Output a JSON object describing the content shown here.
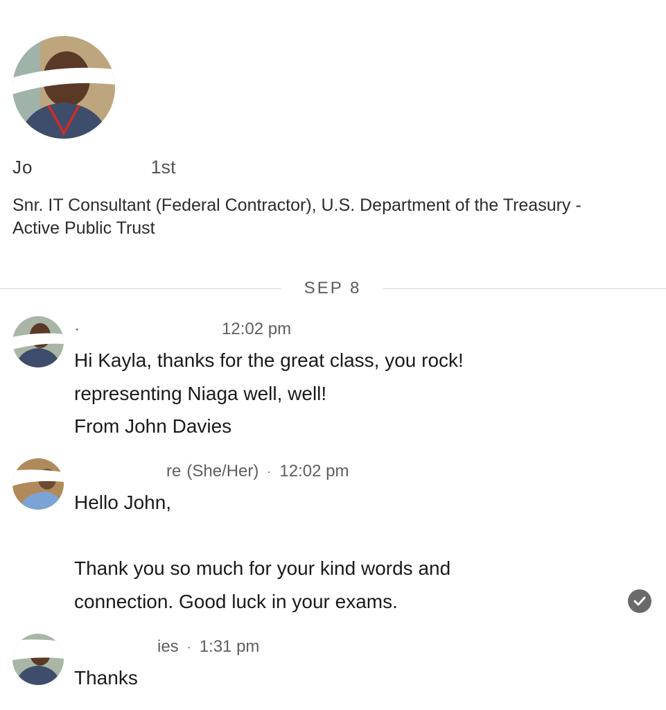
{
  "profile": {
    "name_fragment": "Jo",
    "connection_degree": "1st",
    "headline": "Snr. IT Consultant (Federal Contractor), U.S. Department of the Treasury - Active Public Trust"
  },
  "conversation": {
    "date_divider": "SEP 8",
    "messages": [
      {
        "sender_fragment": "·",
        "timestamp": "12:02 pm",
        "body": "Hi Kayla, thanks for the great class, you rock!\nrepresenting Niaga well, well!\nFrom John Davies"
      },
      {
        "sender_fragment": "re",
        "pronouns": "(She/Her)",
        "separator": "·",
        "timestamp": "12:02 pm",
        "body": "Hello John,\n\nThank you so much for your kind words and\nconnection. Good luck in your exams.",
        "status_icon": "read-check-icon"
      },
      {
        "sender_fragment": "ies",
        "separator": "·",
        "timestamp": "1:31 pm",
        "body": "Thanks"
      }
    ]
  },
  "colors": {
    "background": "#ffffff",
    "divider": "#d6d6d6",
    "muted_text": "#5e5e5e",
    "read_check": "#6a6a6a"
  }
}
